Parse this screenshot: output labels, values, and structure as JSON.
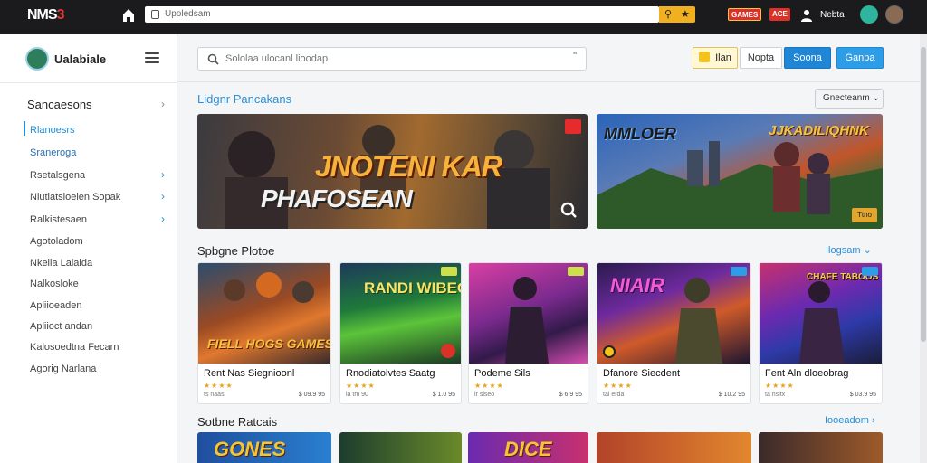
{
  "topbar": {
    "logo_main": "NMS",
    "logo_accent": "3",
    "url": "Upoledsam",
    "badge1": "GAMES",
    "badge2": "ACE",
    "username": "Nebta"
  },
  "sidebar": {
    "brand": "Ualabiale",
    "section": "Sancaesons",
    "items": [
      {
        "label": "Rlanoesrs",
        "active": true
      },
      {
        "label": "Sraneroga",
        "active": false
      },
      {
        "label": "Rsetalsgena",
        "active": false
      },
      {
        "label": "Nlutlatsloeien Sopak",
        "active": false
      },
      {
        "label": "Ralkistesaen",
        "active": false
      },
      {
        "label": "Agotoladom",
        "active": false
      },
      {
        "label": "Nkeila Lalaida",
        "active": false
      },
      {
        "label": "Nalkosloke",
        "active": false
      },
      {
        "label": "Apliioeaden",
        "active": false
      },
      {
        "label": "Apliioct andan",
        "active": false
      },
      {
        "label": "Kalosoedtna Fecarn",
        "active": false
      },
      {
        "label": "Agorig Narlana",
        "active": false
      }
    ]
  },
  "header": {
    "search_placeholder": "Sololaa ulocanl lioodap",
    "search_extra": "\"",
    "btn_gold": "Ilan",
    "btn_plain": "Nopta",
    "btn_blue1": "Soona",
    "btn_blue2": "Ganpa"
  },
  "featured": {
    "title": "Lidgnr Pancakans",
    "sort_label": "Gnecteanm",
    "banner1_line1": "JNOTENI KAR",
    "banner1_line2": "PHAFOSEAN",
    "banner2_left": "MMLOER",
    "banner2_right": "JJKADILIQHNK",
    "banner2_btn": "Ttno"
  },
  "popular": {
    "title": "Spbgne Plotoe",
    "link": "Ilogsam",
    "cards": [
      {
        "name": "Rent Nas Siegnioonl",
        "rating": "★★★★",
        "meta": "ts naas",
        "price": "$ 09.9 95",
        "art_text": "FIELL HOGS GAMES"
      },
      {
        "name": "Rnodiatolvtes Saatg",
        "rating": "★★★★",
        "meta": "la tm 90",
        "price": "$ 1.0 95",
        "art_text": "RANDI WIBEODEN"
      },
      {
        "name": "Podeme Sils",
        "rating": "★★★★",
        "meta": "lr siseo",
        "price": "$ 6.9 95",
        "art_text": ""
      },
      {
        "name": "Dfanore Siecdent",
        "rating": "★★★★",
        "meta": "tal erda",
        "price": "$ 10.2 95",
        "art_text": "NIAIR"
      },
      {
        "name": "Fent Aln dloeobrag",
        "rating": "★★★★",
        "meta": "ta nsitx",
        "price": "$ 03.9 95",
        "art_text": "CHAFE TABOOS"
      }
    ]
  },
  "new_releases": {
    "title": "Sotbne Ratcais",
    "link": "Iooeadom",
    "mini_text1": "GONES",
    "mini_text2": "DICE"
  }
}
